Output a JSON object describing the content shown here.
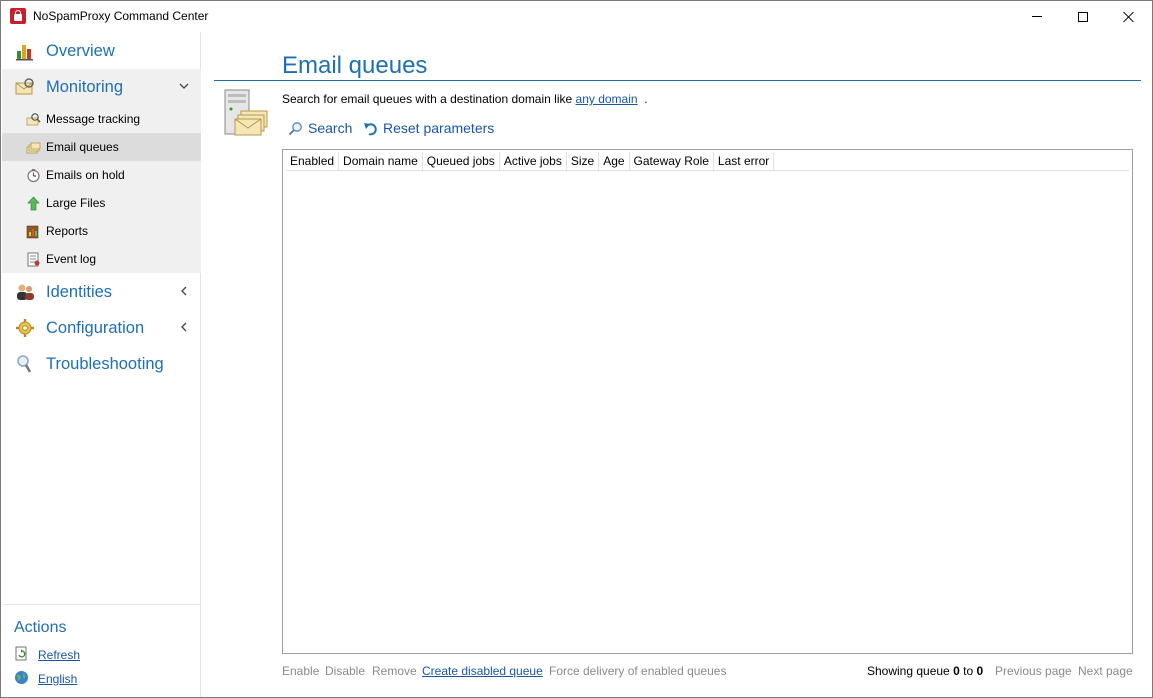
{
  "window": {
    "title": "NoSpamProxy Command Center"
  },
  "sidebar": {
    "overview": "Overview",
    "monitoring": "Monitoring",
    "monitoring_items": [
      {
        "label": "Message tracking"
      },
      {
        "label": "Email queues"
      },
      {
        "label": "Emails on hold"
      },
      {
        "label": "Large Files"
      },
      {
        "label": "Reports"
      },
      {
        "label": "Event log"
      }
    ],
    "identities": "Identities",
    "configuration": "Configuration",
    "troubleshooting": "Troubleshooting",
    "actions_title": "Actions",
    "actions": [
      {
        "label": "Refresh"
      },
      {
        "label": "English"
      }
    ]
  },
  "main": {
    "title": "Email queues",
    "search_prefix": "Search for email queues with a destination domain like",
    "search_link": "any domain",
    "search_suffix": ".",
    "search_button": "Search",
    "reset_button": "Reset parameters",
    "columns": [
      "Enabled",
      "Domain name",
      "Queued jobs",
      "Active jobs",
      "Size",
      "Age",
      "Gateway Role",
      "Last error"
    ]
  },
  "footer": {
    "enable": "Enable",
    "disable": "Disable",
    "remove": "Remove",
    "create_disabled": "Create disabled queue",
    "force_delivery": "Force delivery of enabled queues",
    "showing_prefix": "Showing queue",
    "showing_from": "0",
    "showing_to_word": "to",
    "showing_to": "0",
    "previous_page": "Previous page",
    "next_page": "Next page"
  },
  "colors": {
    "accent": "#1e6fb3",
    "link": "#1a56a6",
    "disabled": "#8a8a8a",
    "selected_bg": "#dcdcdc",
    "section_bg": "#f0f0f0"
  }
}
